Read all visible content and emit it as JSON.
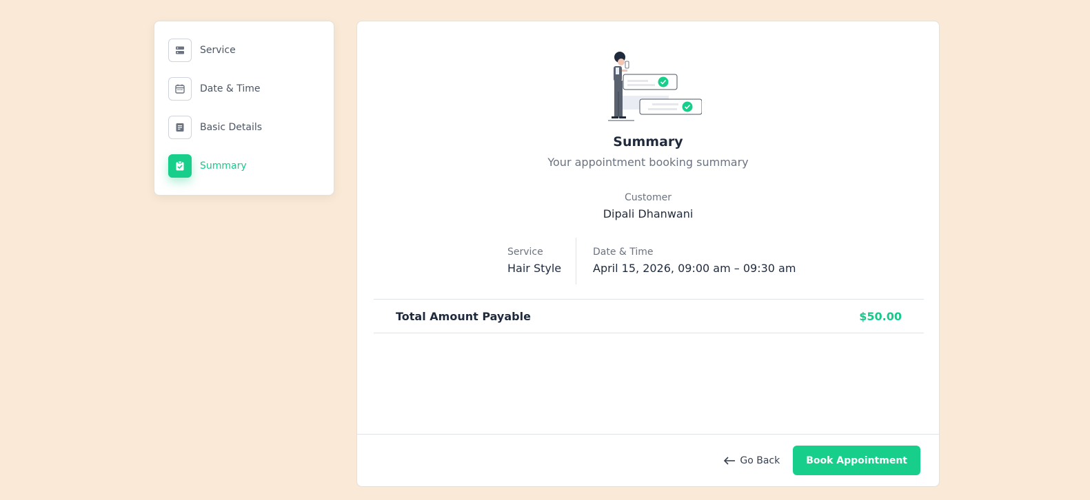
{
  "sidebar": {
    "items": [
      {
        "label": "Service",
        "icon": "server-icon",
        "active": false
      },
      {
        "label": "Date & Time",
        "icon": "calendar-icon",
        "active": false
      },
      {
        "label": "Basic Details",
        "icon": "document-icon",
        "active": false
      },
      {
        "label": "Summary",
        "icon": "clipboard-check-icon",
        "active": true
      }
    ]
  },
  "main": {
    "title": "Summary",
    "subtitle": "Your appointment booking summary",
    "customer_label": "Customer",
    "customer_name": "Dipali Dhanwani",
    "service_label": "Service",
    "service_value": "Hair Style",
    "datetime_label": "Date & Time",
    "datetime_value": "April 15, 2026, 09:00 am – 09:30 am",
    "total_label": "Total Amount Payable",
    "total_value": "$50.00"
  },
  "footer": {
    "back_label": "Go Back",
    "book_label": "Book Appointment"
  },
  "colors": {
    "accent": "#17cf8b",
    "background": "#f9e9d6"
  }
}
